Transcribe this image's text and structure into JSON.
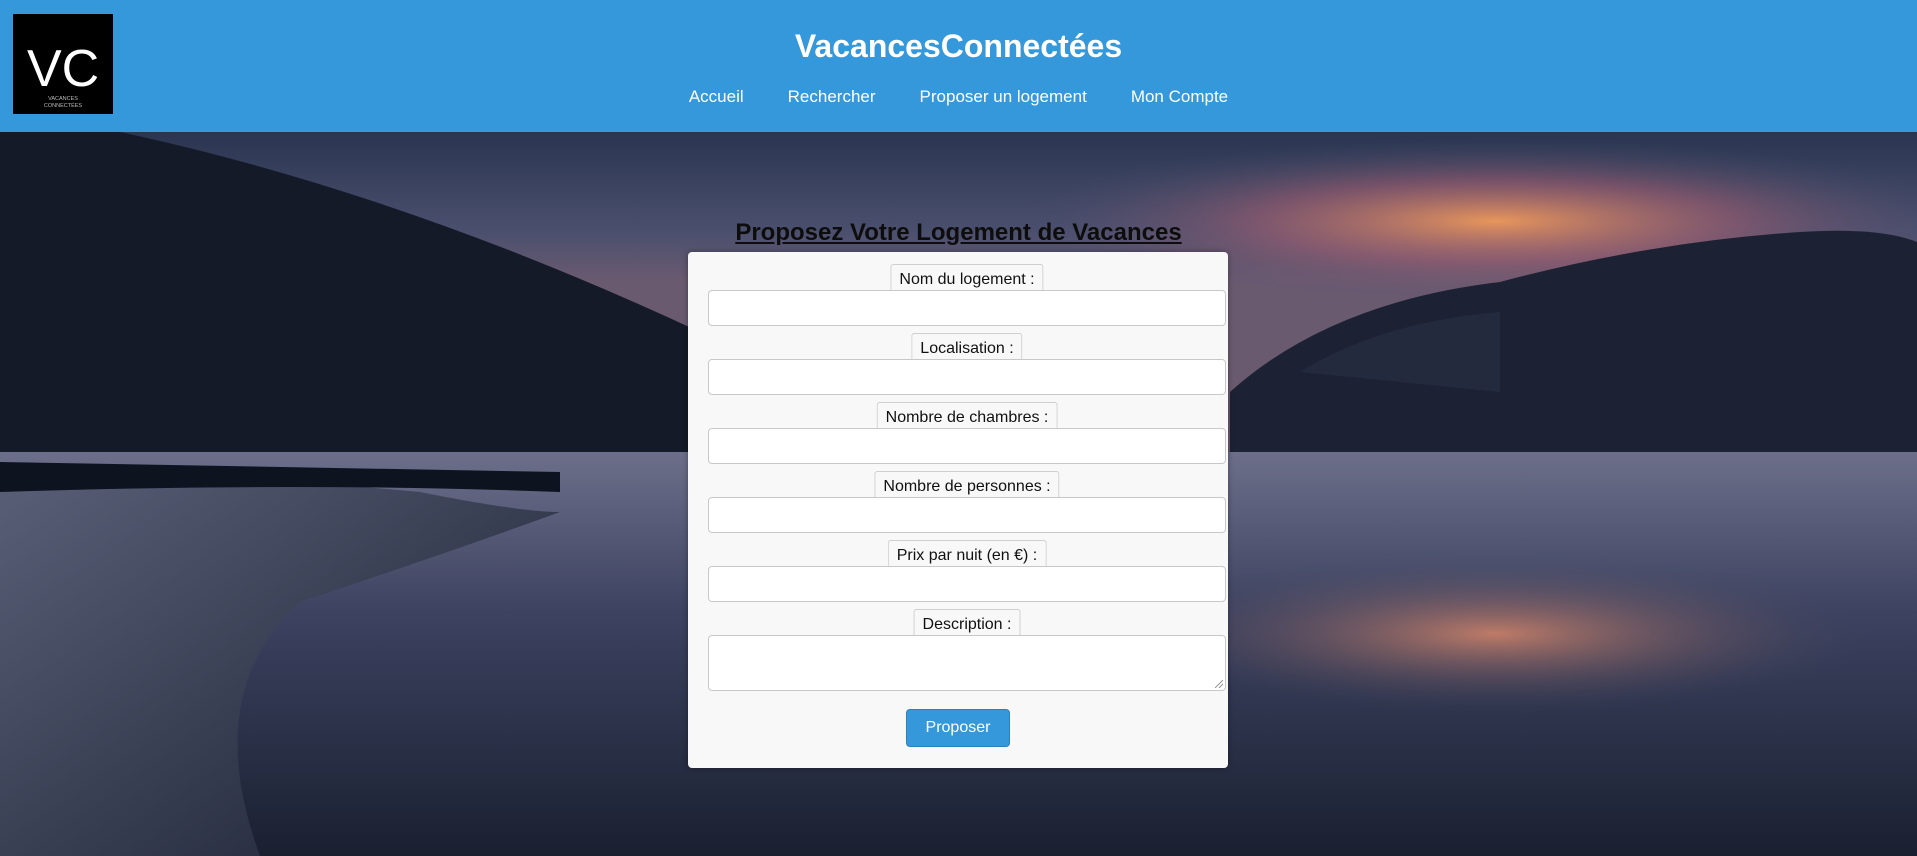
{
  "header": {
    "brand": "VacancesConnectées",
    "logo": {
      "letters": "VC",
      "tagline_line1": "VACANCES",
      "tagline_line2": "CONNECTÉES"
    },
    "nav": [
      "Accueil",
      "Rechercher",
      "Proposer un logement",
      "Mon Compte"
    ]
  },
  "main": {
    "title": "Proposez Votre Logement de Vacances",
    "fields": [
      {
        "label": "Nom du logement :",
        "value": ""
      },
      {
        "label": "Localisation :",
        "value": ""
      },
      {
        "label": "Nombre de chambres :",
        "value": ""
      },
      {
        "label": "Nombre de personnes :",
        "value": ""
      },
      {
        "label": "Prix par nuit (en €) :",
        "value": ""
      },
      {
        "label": "Description :",
        "value": ""
      }
    ],
    "submit_label": "Proposer"
  },
  "colors": {
    "accent": "#3498db",
    "card": "#f8f8f8"
  }
}
